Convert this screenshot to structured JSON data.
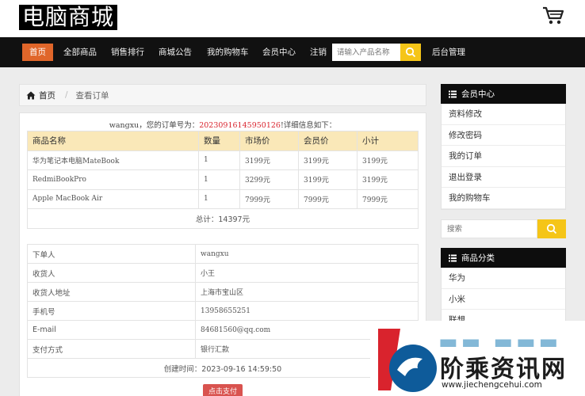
{
  "header": {
    "logo_text": "电脑商城"
  },
  "nav": {
    "items": [
      "首页",
      "全部商品",
      "销售排行",
      "商城公告",
      "我的购物车",
      "会员中心",
      "注销"
    ],
    "search_placeholder": "请输入产品名称",
    "admin": "后台管理"
  },
  "breadcrumb": {
    "home": "首页",
    "current": "查看订单"
  },
  "order": {
    "user": "wangxu",
    "text_before": "，您的订单号为：",
    "number": "20230916145950126",
    "text_after": "!详细信息如下：",
    "columns": [
      "商品名称",
      "数量",
      "市场价",
      "会员价",
      "小计"
    ],
    "rows": [
      [
        "华为笔记本电脑MateBook",
        "1",
        "3199元",
        "3199元",
        "3199元"
      ],
      [
        "RedmiBookPro",
        "1",
        "3299元",
        "3199元",
        "3199元"
      ],
      [
        "Apple MacBook Air",
        "1",
        "7999元",
        "7999元",
        "7999元"
      ]
    ],
    "total": "总计：14397元"
  },
  "info": {
    "rows": [
      [
        "下单人",
        "wangxu"
      ],
      [
        "收货人",
        "小王"
      ],
      [
        "收货人地址",
        "上海市宝山区"
      ],
      [
        "手机号",
        "13958655251"
      ],
      [
        "E-mail",
        "84681560@qq.com"
      ],
      [
        "支付方式",
        "银行汇款"
      ]
    ],
    "created": "创建时间：2023-09-16 14:59:50",
    "pay_button": "点击支付"
  },
  "sidebar": {
    "member_title": "会员中心",
    "member_items": [
      "资料修改",
      "修改密码",
      "我的订单",
      "退出登录",
      "我的购物车"
    ],
    "search_placeholder": "搜索",
    "category_title": "商品分类",
    "category_items": [
      "华为",
      "小米",
      "联想"
    ]
  },
  "watermark": {
    "main": "阶乘资讯网",
    "url": "www.jiechengcehui.com"
  },
  "colors": {
    "nav_bg": "#111111",
    "nav_active": "#e0662a",
    "search_button": "#f5c518",
    "table_header": "#fae8b8",
    "order_number": "#d9232d",
    "pay_button": "#d9534f"
  }
}
